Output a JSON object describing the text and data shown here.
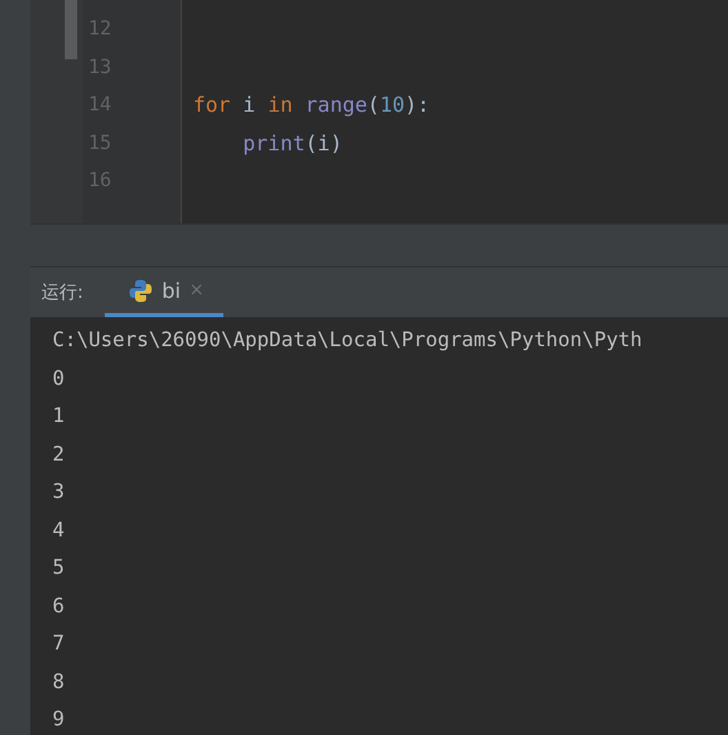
{
  "editor": {
    "lines": [
      {
        "number": "12"
      },
      {
        "number": "13"
      },
      {
        "number": "14",
        "indented": false,
        "tokens": [
          {
            "kind": "keyword",
            "text": "for"
          },
          {
            "kind": "plain",
            "text": " i "
          },
          {
            "kind": "keyword",
            "text": "in"
          },
          {
            "kind": "builtin",
            "text": "range",
            "space_before": true
          },
          {
            "kind": "plain",
            "text": "("
          },
          {
            "kind": "number",
            "text": "10"
          },
          {
            "kind": "plain",
            "text": "):"
          }
        ]
      },
      {
        "number": "15",
        "indented": true,
        "tokens": [
          {
            "kind": "builtin",
            "text": "print"
          },
          {
            "kind": "plain",
            "text": "(i)"
          }
        ]
      },
      {
        "number": "16"
      }
    ]
  },
  "run_panel": {
    "label": "运行:",
    "tabs": [
      {
        "label": "bi",
        "close": "×",
        "selected": true
      }
    ]
  },
  "console": {
    "lines": [
      "C:\\Users\\26090\\AppData\\Local\\Programs\\Python\\Pyth",
      "0",
      "1",
      "2",
      "3",
      "4",
      "5",
      "6",
      "7",
      "8",
      "9"
    ]
  }
}
